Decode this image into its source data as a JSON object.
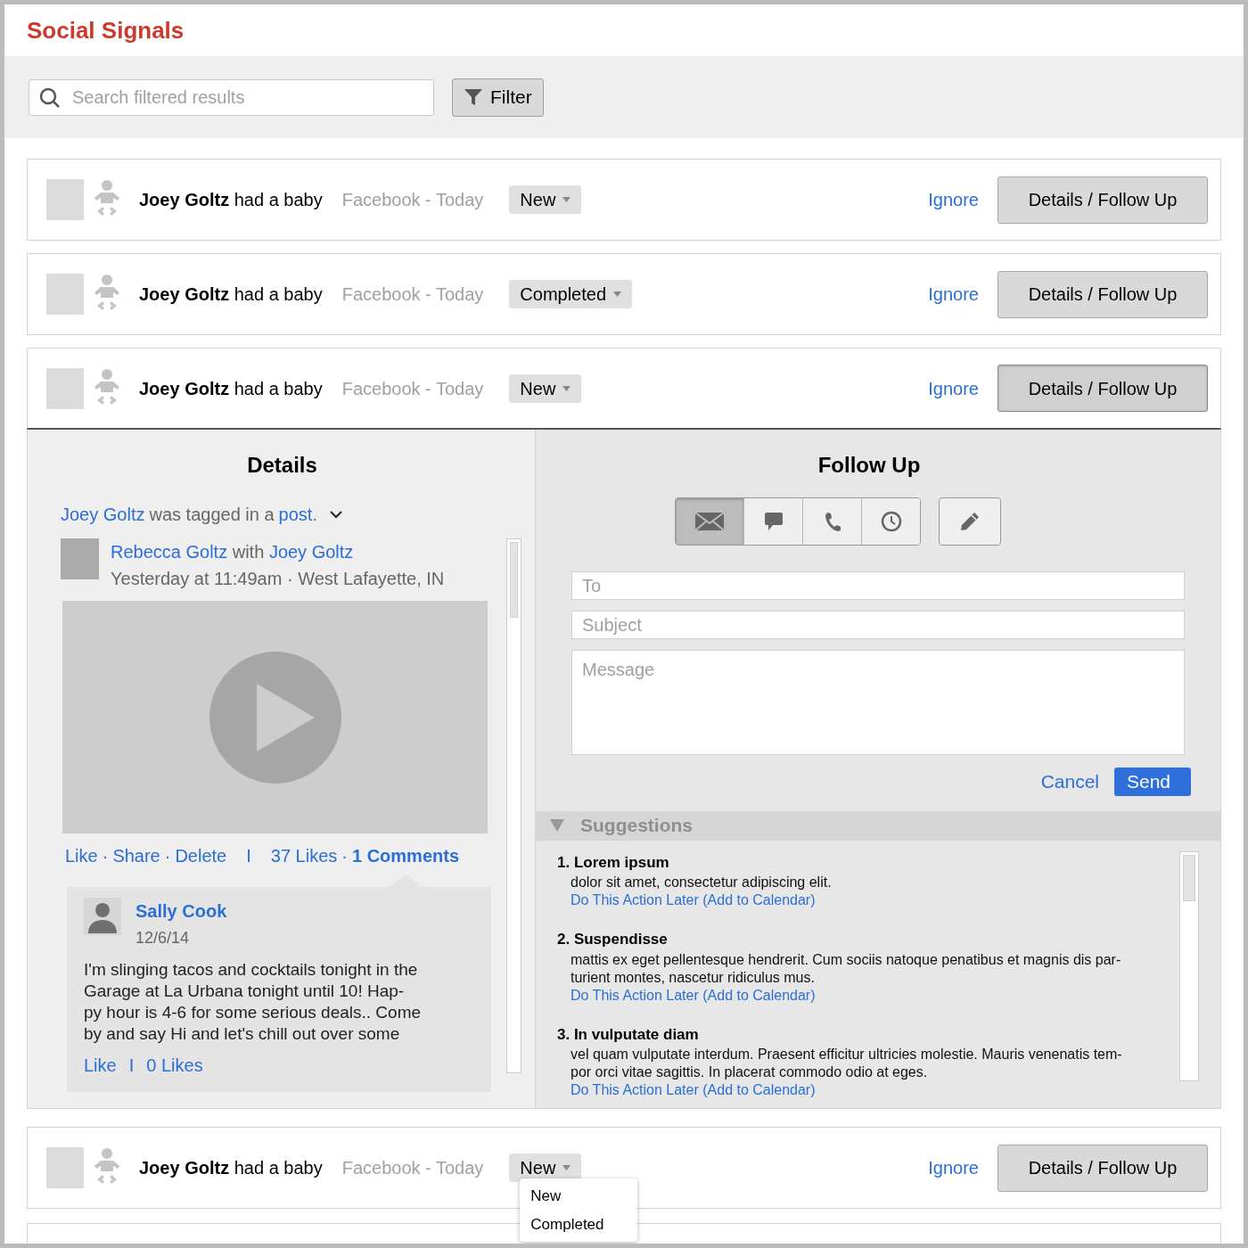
{
  "app": {
    "title": "Social Signals"
  },
  "toolbar": {
    "search": {
      "placeholder": "Search filtered results"
    },
    "filter": "Filter"
  },
  "signals": [
    {
      "name": "Joey Goltz",
      "event": "had a baby",
      "source": "Facebook - Today",
      "status": "New",
      "ignore": "Ignore",
      "action": "Details / Follow Up",
      "expanded": false
    },
    {
      "name": "Joey Goltz",
      "event": "had a baby",
      "source": "Facebook - Today",
      "status": "Completed",
      "ignore": "Ignore",
      "action": "Details / Follow Up",
      "expanded": false
    },
    {
      "name": "Joey Goltz",
      "event": "had a baby",
      "source": "Facebook - Today",
      "status": "New",
      "ignore": "Ignore",
      "action": "Details / Follow Up",
      "expanded": true
    },
    {
      "name": "Joey Goltz",
      "event": "had a baby",
      "source": "Facebook - Today",
      "status": "New",
      "ignore": "Ignore",
      "action": "Details / Follow Up",
      "expanded": false,
      "menu": [
        "New",
        "Completed"
      ]
    }
  ],
  "details": {
    "title": "Details",
    "tag_line": [
      {
        "kind": "link",
        "text": "Joey Goltz"
      },
      {
        "kind": "text",
        "text": "was tagged in a"
      },
      {
        "kind": "link",
        "text": "post"
      },
      {
        "kind": "text",
        "text": "."
      }
    ],
    "post": {
      "author": "Rebecca Goltz",
      "with": "with",
      "friend": "Joey Goltz",
      "meta": "Yesterday at 11:49am · West Lafayette, IN",
      "actions": [
        "Like",
        "Share",
        "Delete"
      ],
      "dot": "·",
      "divider": "I",
      "likes": "37 Likes",
      "comments": "1 Comments"
    },
    "comment": {
      "author": "Sally Cook",
      "date": "12/6/14",
      "lines": [
        "I'm slinging tacos and cocktails tonight in the",
        "Garage at La Urbana tonight until 10! Hap-",
        "py hour is 4-6 for some serious deals.. Come",
        "by and say Hi and let's chill out over some"
      ],
      "like": "Like",
      "divider": "I",
      "likes": "0 Likes"
    }
  },
  "follow_up": {
    "title": "Follow Up",
    "modes": [
      {
        "kind": "email",
        "selected": true
      },
      {
        "kind": "chat",
        "selected": false
      },
      {
        "kind": "phone",
        "selected": false
      },
      {
        "kind": "clock",
        "selected": false
      }
    ],
    "to": {
      "placeholder": "To"
    },
    "subject": {
      "placeholder": "Subject"
    },
    "message": {
      "placeholder": "Message"
    },
    "cancel": "Cancel",
    "send": "Send",
    "suggestions": {
      "title": "Suggestions",
      "expanded": true,
      "items": [
        {
          "title": "1. Lorem ipsum",
          "lines": [
            "dolor sit amet, consectetur adipiscing elit."
          ],
          "link": "Do This Action Later (Add to Calendar)"
        },
        {
          "title": "2. Suspendisse",
          "lines": [
            "mattis ex eget pellentesque hendrerit. Cum sociis natoque penatibus et magnis dis par-",
            "turient montes, nascetur ridiculus mus."
          ],
          "link": "Do This Action Later (Add to Calendar)"
        },
        {
          "title": "3. In vulputate diam",
          "lines": [
            "vel quam vulputate interdum. Praesent efficitur ultricies molestie. Mauris venenatis tem-",
            "por orci vitae sagittis. In placerat commodo odio at eges."
          ],
          "link": "Do This Action Later (Add to Calendar)"
        }
      ]
    }
  }
}
